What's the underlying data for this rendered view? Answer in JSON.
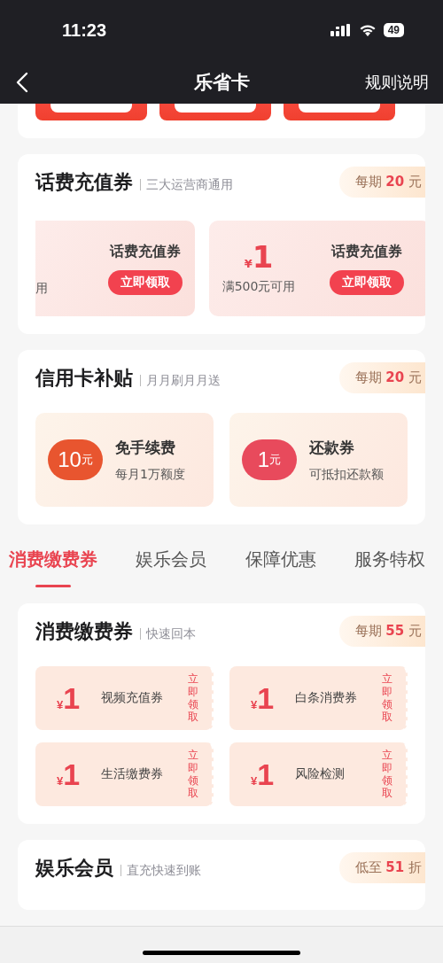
{
  "status_bar": {
    "time": "11:23",
    "battery": "49"
  },
  "nav": {
    "title": "乐省卡",
    "action": "规则说明"
  },
  "top_strip": [
    {
      "kind": "claim"
    },
    {
      "kind": "claim"
    },
    {
      "kind": "claim"
    }
  ],
  "phone_section": {
    "title": "话费充值券",
    "subtitle": "三大运营商通用",
    "badge": {
      "prefix": "每期",
      "value": "20",
      "suffix": "元"
    },
    "coupons": [
      {
        "kind": "partial",
        "condition": "用",
        "name": "话费充值券",
        "button": "立即领取"
      },
      {
        "kind": "full",
        "currency": "¥",
        "amount": "1",
        "condition": "满500元可用",
        "name": "话费充值券",
        "button": "立即领取"
      }
    ]
  },
  "credit_section": {
    "title": "信用卡补贴",
    "subtitle": "月月刷月月送",
    "badge": {
      "prefix": "每期",
      "value": "20",
      "suffix": "元"
    },
    "tiles": [
      {
        "value": "10",
        "unit": "元",
        "color": "#e8552f",
        "title": "免手续费",
        "desc": "每月1万额度"
      },
      {
        "value": "1",
        "unit": "元",
        "color": "#e84a5c",
        "title": "还款券",
        "desc": "可抵扣还款额"
      }
    ]
  },
  "tabs": [
    {
      "label": "消费缴费券",
      "selected": true
    },
    {
      "label": "娱乐会员",
      "selected": false
    },
    {
      "label": "保障优惠",
      "selected": false
    },
    {
      "label": "服务特权",
      "selected": false
    }
  ],
  "consume_section": {
    "title": "消费缴费券",
    "subtitle": "快速回本",
    "badge": {
      "prefix": "每期",
      "value": "55",
      "suffix": "元"
    },
    "coupons": [
      {
        "currency": "¥",
        "amount": "1",
        "name": "视频充值券",
        "action": "立即领取"
      },
      {
        "currency": "¥",
        "amount": "1",
        "name": "白条消费券",
        "action": "立即领取"
      },
      {
        "currency": "¥",
        "amount": "1",
        "name": "生活缴费券",
        "action": "立即领取"
      },
      {
        "currency": "¥",
        "amount": "1",
        "name": "风险检测",
        "action": "立即领取"
      }
    ]
  },
  "member_section": {
    "title": "娱乐会员",
    "subtitle": "直充快速到账",
    "badge": {
      "prefix": "低至",
      "value": "51",
      "suffix": "折"
    }
  }
}
